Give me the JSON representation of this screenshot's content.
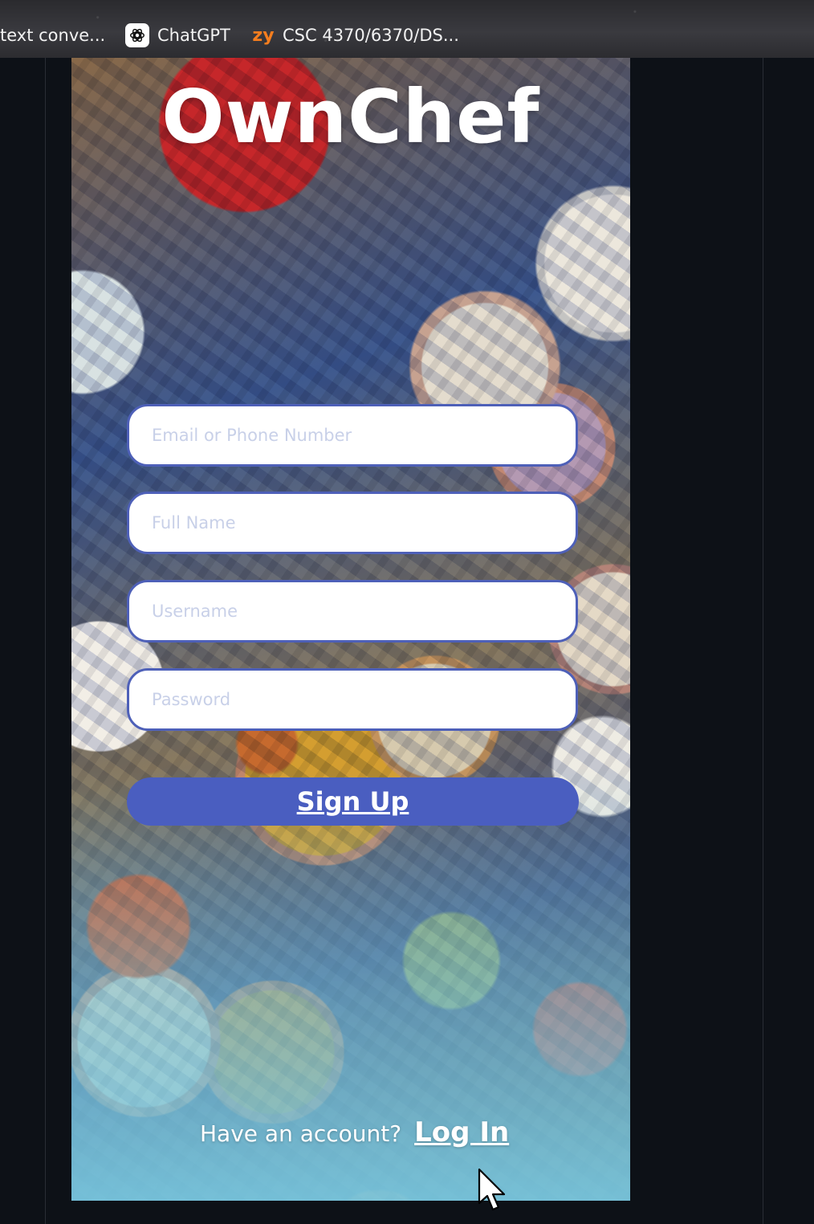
{
  "bookmarks": [
    {
      "label": "text conve...",
      "icon": ""
    },
    {
      "label": "ChatGPT",
      "icon": "chatgpt-icon"
    },
    {
      "label": "CSC 4370/6370/DS...",
      "icon": "zybooks-icon",
      "icon_text": "zy"
    }
  ],
  "app": {
    "title": "OwnChef"
  },
  "form": {
    "email_placeholder": "Email or Phone Number",
    "email_value": "",
    "full_name_placeholder": "Full Name",
    "full_name_value": "",
    "username_placeholder": "Username",
    "username_value": "",
    "password_placeholder": "Password",
    "password_value": "",
    "signup_label": "Sign Up"
  },
  "footer": {
    "prompt": "Have an account?",
    "login_label": "Log In"
  },
  "colors": {
    "accent": "#4a5ec0",
    "field_border": "#4e60b8",
    "placeholder": "#c8d0e8",
    "page_background": "#0d1117",
    "bottom_fade": "#78c8e1",
    "zybooks_orange": "#f47d1e"
  }
}
